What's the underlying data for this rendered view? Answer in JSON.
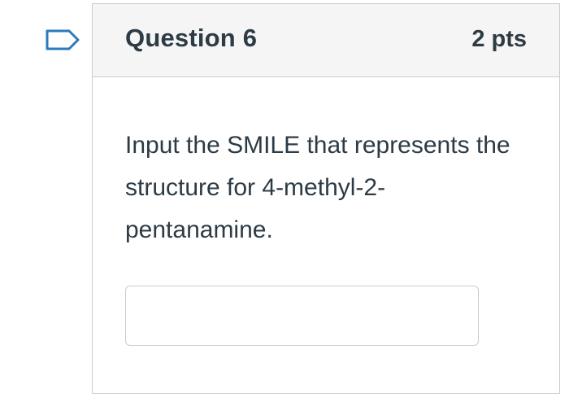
{
  "question": {
    "title": "Question 6",
    "points": "2 pts",
    "text": "Input the SMILE that represents the structure for 4-methyl-2-pentanamine.",
    "flag_icon": "flag-outline-icon",
    "answer": {
      "value": "",
      "placeholder": ""
    }
  },
  "colors": {
    "header_bg": "#f5f5f5",
    "border": "#c7cdd1",
    "text": "#2d3b45",
    "flag_stroke": "#2b7abc"
  }
}
